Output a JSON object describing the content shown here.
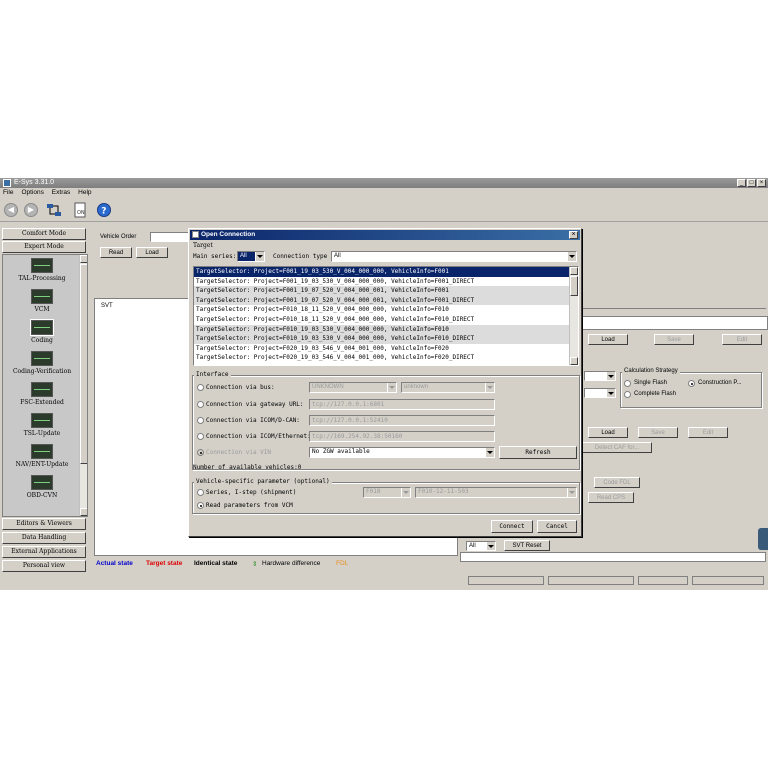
{
  "window": {
    "title": "E-Sys 3.31.0"
  },
  "menu": [
    "File",
    "Options",
    "Extras",
    "Help"
  ],
  "sidebar": {
    "top_buttons": [
      "Comfort Mode",
      "Expert Mode"
    ],
    "tools": [
      "TAL-Processing",
      "VCM",
      "Coding",
      "Coding-Verification",
      "FSC-Extended",
      "TSL-Update",
      "NAV/ENT-Update",
      "OBD-CVN"
    ],
    "bottom_buttons": [
      "Editors & Viewers",
      "Data Handling",
      "External Applications",
      "Personal view"
    ]
  },
  "main": {
    "vehicle_order_label": "Vehicle Order",
    "read_label": "Read",
    "load_label": "Load",
    "svt_label": "SVT",
    "legend": {
      "actual": "Actual state",
      "target": "Target state",
      "identical": "Identical state",
      "hardware": "Hardware difference",
      "fdl": "FDL"
    }
  },
  "right_panel": {
    "load1": "Load",
    "save1": "Save",
    "edit1": "Edit",
    "calc_strategy_title": "Calculation Strategy",
    "single_flash": "Single Flash",
    "construction": "Construction P...",
    "complete_flash": "Complete Flash",
    "load2": "Load",
    "save2": "Save",
    "edit2": "Edit",
    "detect_caf": "Detect CAF for...",
    "code_fdl": "Code FDL",
    "read_cps": "Read CPS",
    "all_value": "All",
    "svt_reset": "SVT Reset"
  },
  "dialog": {
    "title": "Open Connection",
    "target_group": "Target",
    "main_series_label": "Main series:",
    "main_series_value": "All",
    "connection_type_label": "Connection type",
    "connection_type_value": "All",
    "target_list": [
      "TargetSelector: Project=F001_19_03_530_V_004_000_000, VehicleInfo=F001",
      "TargetSelector: Project=F001_19_03_530_V_004_000_000, VehicleInfo=F001_DIRECT",
      "TargetSelector: Project=F001_19_07_520_V_004_000_001, VehicleInfo=F001",
      "TargetSelector: Project=F001_19_07_520_V_004_000_001, VehicleInfo=F001_DIRECT",
      "TargetSelector: Project=F010_18_11_520_V_004_000_000, VehicleInfo=F010",
      "TargetSelector: Project=F010_18_11_520_V_004_000_000, VehicleInfo=F010_DIRECT",
      "TargetSelector: Project=F010_19_03_530_V_004_000_000, VehicleInfo=F010",
      "TargetSelector: Project=F010_19_03_530_V_004_000_000, VehicleInfo=F010_DIRECT",
      "TargetSelector: Project=F020_19_03_546_V_004_001_000, VehicleInfo=F020",
      "TargetSelector: Project=F020_19_03_546_V_004_001_000, VehicleInfo=F020_DIRECT"
    ],
    "interface_group": "Interface",
    "via_bus": "Connection via bus:",
    "bus_value1": "UNKNOWN",
    "bus_value2": "unknown",
    "via_gateway": "Connection via gateway URL:",
    "gateway_url": "tcp://127.0.0.1:6801",
    "via_dcan": "Connection via ICOM/D-CAN:",
    "dcan_url": "tcp://127.0.0.1:52410",
    "via_ethernet": "Connection via ICOM/Ethernet:",
    "ethernet_url": "tcp://169.254.92.38:50160",
    "via_vin": "Connection via VIN",
    "vin_value": "No ZGW available",
    "refresh": "Refresh",
    "vehicle_count": "Number of available vehicles:0",
    "vehicle_param_group": "Vehicle-specific parameter (optional)",
    "series_istep": "Series, I-step (shipment)",
    "series_value": "F018",
    "istep_value": "F010-12-11-503",
    "read_from_vcm": "Read parameters from VCM",
    "connect": "Connect",
    "cancel": "Cancel"
  },
  "colors": {
    "actual": "#0000cc",
    "target": "#dd0000",
    "hardware": "#2a8a2a",
    "fdl": "#e89020",
    "selection": "#0a246a"
  }
}
